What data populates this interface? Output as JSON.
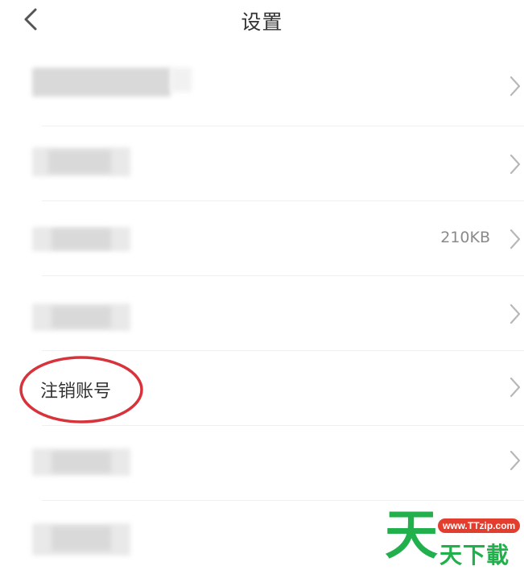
{
  "header": {
    "title": "设置",
    "back_icon": "chevron-left-icon"
  },
  "rows": [
    {
      "label": "",
      "value": ""
    },
    {
      "label": "",
      "value": ""
    },
    {
      "label": "",
      "value": "210KB"
    },
    {
      "label": "",
      "value": ""
    },
    {
      "label": "注销账号",
      "value": ""
    },
    {
      "label": "",
      "value": ""
    },
    {
      "label": "",
      "value": ""
    }
  ],
  "highlight": {
    "color": "#d8333b"
  },
  "watermark": {
    "big_char": "天",
    "url": "www.TTzip.com",
    "text": "天下載"
  }
}
